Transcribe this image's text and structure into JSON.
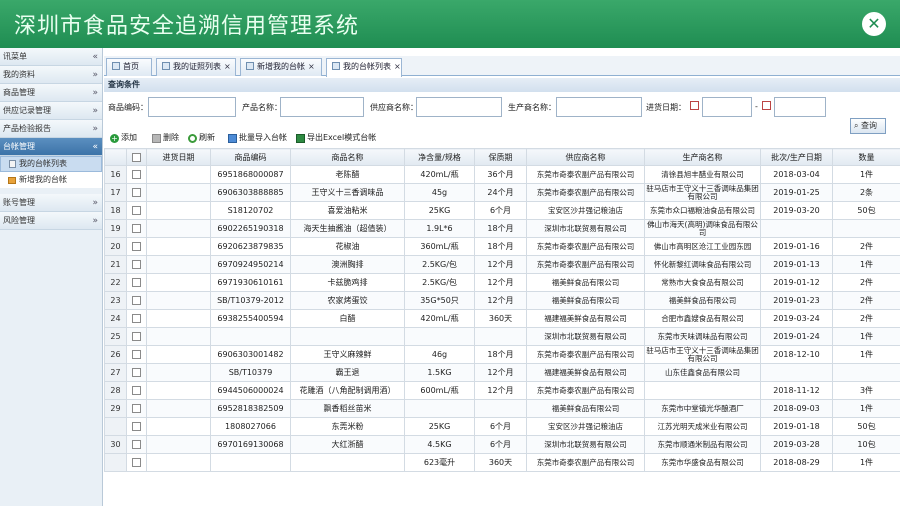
{
  "app": {
    "title": "深圳市食品安全追溯信用管理系统",
    "close_icon": "close-icon"
  },
  "sidebar": {
    "items": [
      {
        "label": "讯菜单",
        "chev": "«"
      },
      {
        "label": "我的资料",
        "chev": "»"
      },
      {
        "label": "商品管理",
        "chev": "»"
      },
      {
        "label": "供应记录管理",
        "chev": "»"
      },
      {
        "label": "产品检验报告",
        "chev": "»"
      },
      {
        "label": "台帐管理",
        "chev": "«"
      }
    ],
    "sub_items": [
      {
        "label": "我的台帐列表"
      },
      {
        "label": "新增我的台帐"
      }
    ],
    "items_after": [
      {
        "label": "账号管理",
        "chev": "»"
      },
      {
        "label": "风险管理",
        "chev": "»"
      }
    ]
  },
  "tabs": [
    {
      "label": "首页",
      "closable": false
    },
    {
      "label": "我的证照列表",
      "closable": true
    },
    {
      "label": "新增我的台帐",
      "closable": true
    },
    {
      "label": "我的台帐列表",
      "closable": true
    }
  ],
  "query": {
    "title": "查询条件",
    "product_code_label": "商品编码：",
    "product_name_label": "产品名称：",
    "supplier_label": "供应商名称：",
    "manufacturer_label": "生产商名称：",
    "date_label": "进货日期：",
    "date_sep": "-",
    "search_label": "查询"
  },
  "toolbar": {
    "add": "添加",
    "delete": "删除",
    "refresh": "刷新",
    "import": "批量导入台帐",
    "export": "导出Excel模式台帐"
  },
  "table": {
    "columns": [
      "",
      "",
      "进货日期",
      "商品编码",
      "商品名称",
      "净含量/规格",
      "保质期",
      "供应商名称",
      "生产商名称",
      "批次/生产日期",
      "数量"
    ],
    "rows": [
      {
        "n": "16",
        "date": "",
        "code": "6951868000087",
        "name": "老陈醋",
        "spec": "420mL/瓶",
        "shelf": "36个月",
        "supplier": "东莞市奇泰农副产品有限公司",
        "maker": "清徐县旭丰醋业有限公司",
        "batch": "2018-03-04",
        "qty": "1件"
      },
      {
        "n": "17",
        "date": "",
        "code": "6906303888885",
        "name": "王守义十三香调味品",
        "spec": "45g",
        "shelf": "24个月",
        "supplier": "东莞市奇泰农副产品有限公司",
        "maker": "驻马店市王守义十三香调味品集团有限公司",
        "batch": "2019-01-25",
        "qty": "2条"
      },
      {
        "n": "18",
        "date": "",
        "code": "S18120702",
        "name": "喜爱油粘米",
        "spec": "25KG",
        "shelf": "6个月",
        "supplier": "宝安区沙井强记粮油店",
        "maker": "东莞市众口福粮油食品有限公司",
        "batch": "2019-03-20",
        "qty": "50包"
      },
      {
        "n": "19",
        "date": "",
        "code": "6902265190318",
        "name": "海天生抽酱油（超值装）",
        "spec": "1.9L*6",
        "shelf": "18个月",
        "supplier": "深圳市北联贸易有限公司",
        "maker": "佛山市海天(高明)调味食品有限公司",
        "batch": "",
        "qty": ""
      },
      {
        "n": "20",
        "date": "",
        "code": "6920623879835",
        "name": "花椒油",
        "spec": "360mL/瓶",
        "shelf": "18个月",
        "supplier": "东莞市奇泰农副产品有限公司",
        "maker": "佛山市高明区沧江工业园东园",
        "batch": "2019-01-16",
        "qty": "2件"
      },
      {
        "n": "21",
        "date": "",
        "code": "6970924950214",
        "name": "澳洲胸排",
        "spec": "2.5KG/包",
        "shelf": "12个月",
        "supplier": "东莞市奇泰农副产品有限公司",
        "maker": "怀化新黎红调味食品有限公司",
        "batch": "2019-01-13",
        "qty": "1件"
      },
      {
        "n": "22",
        "date": "",
        "code": "6971930610161",
        "name": "卡兹脆鸡排",
        "spec": "2.5KG/包",
        "shelf": "12个月",
        "supplier": "福美鲜食品有限公司",
        "maker": "常熟市大食食品有限公司",
        "batch": "2019-01-12",
        "qty": "2件"
      },
      {
        "n": "23",
        "date": "",
        "code": "SB/T10379-2012",
        "name": "农家烤蛋饺",
        "spec": "35G*50只",
        "shelf": "12个月",
        "supplier": "福美鲜食品有限公司",
        "maker": "福美鲜食品有限公司",
        "batch": "2019-01-23",
        "qty": "2件"
      },
      {
        "n": "24",
        "date": "",
        "code": "6938255400594",
        "name": "白醋",
        "spec": "420mL/瓶",
        "shelf": "360天",
        "supplier": "福建福美鲜食品有限公司",
        "maker": "合肥市鑫嫂食品有限公司",
        "batch": "2019-03-24",
        "qty": "2件"
      },
      {
        "n": "25",
        "date": "",
        "code": "",
        "name": "",
        "spec": "",
        "shelf": "",
        "supplier": "深圳市北联贸易有限公司",
        "maker": "东莞市天味调味品有限公司",
        "batch": "2019-01-24",
        "qty": "1件"
      },
      {
        "n": "26",
        "date": "",
        "code": "6906303001482",
        "name": "王守义麻辣鲜",
        "spec": "46g",
        "shelf": "18个月",
        "supplier": "东莞市奇泰农副产品有限公司",
        "maker": "驻马店市王守义十三香调味品集团有限公司",
        "batch": "2018-12-10",
        "qty": "1件"
      },
      {
        "n": "27",
        "date": "",
        "code": "SB/T10379",
        "name": "霸王退",
        "spec": "1.5KG",
        "shelf": "12个月",
        "supplier": "福建福美鲜食品有限公司",
        "maker": "山东佳鑫食品有限公司",
        "batch": "",
        "qty": ""
      },
      {
        "n": "28",
        "date": "",
        "code": "6944506000024",
        "name": "花雕酒（八角配制调用酒）",
        "spec": "600mL/瓶",
        "shelf": "12个月",
        "supplier": "东莞市奇泰农副产品有限公司",
        "maker": "",
        "batch": "2018-11-12",
        "qty": "3件"
      },
      {
        "n": "29",
        "date": "",
        "code": "6952818382509",
        "name": "飘香稻丝苗米",
        "spec": "",
        "shelf": "",
        "supplier": "福美鲜食品有限公司",
        "maker": "东莞市中堂镇光华酿酒厂",
        "batch": "2018-09-03",
        "qty": "1件"
      },
      {
        "n": "",
        "date": "",
        "code": "1808027066",
        "name": "东莞米粉",
        "spec": "25KG",
        "shelf": "6个月",
        "supplier": "宝安区沙井强记粮油店",
        "maker": "江苏光明天成米业有限公司",
        "batch": "2019-01-18",
        "qty": "50包"
      },
      {
        "n": "30",
        "date": "",
        "code": "6970169130068",
        "name": "大红浙醋",
        "spec": "4.5KG",
        "shelf": "6个月",
        "supplier": "深圳市北联贸易有限公司",
        "maker": "东莞市顺通米制品有限公司",
        "batch": "2019-03-28",
        "qty": "10包"
      },
      {
        "n": "",
        "date": "",
        "code": "",
        "name": "",
        "spec": "623毫升",
        "shelf": "360天",
        "supplier": "东莞市奇泰农副产品有限公司",
        "maker": "东莞市华盛食品有限公司",
        "batch": "2018-08-29",
        "qty": "1件"
      }
    ]
  }
}
